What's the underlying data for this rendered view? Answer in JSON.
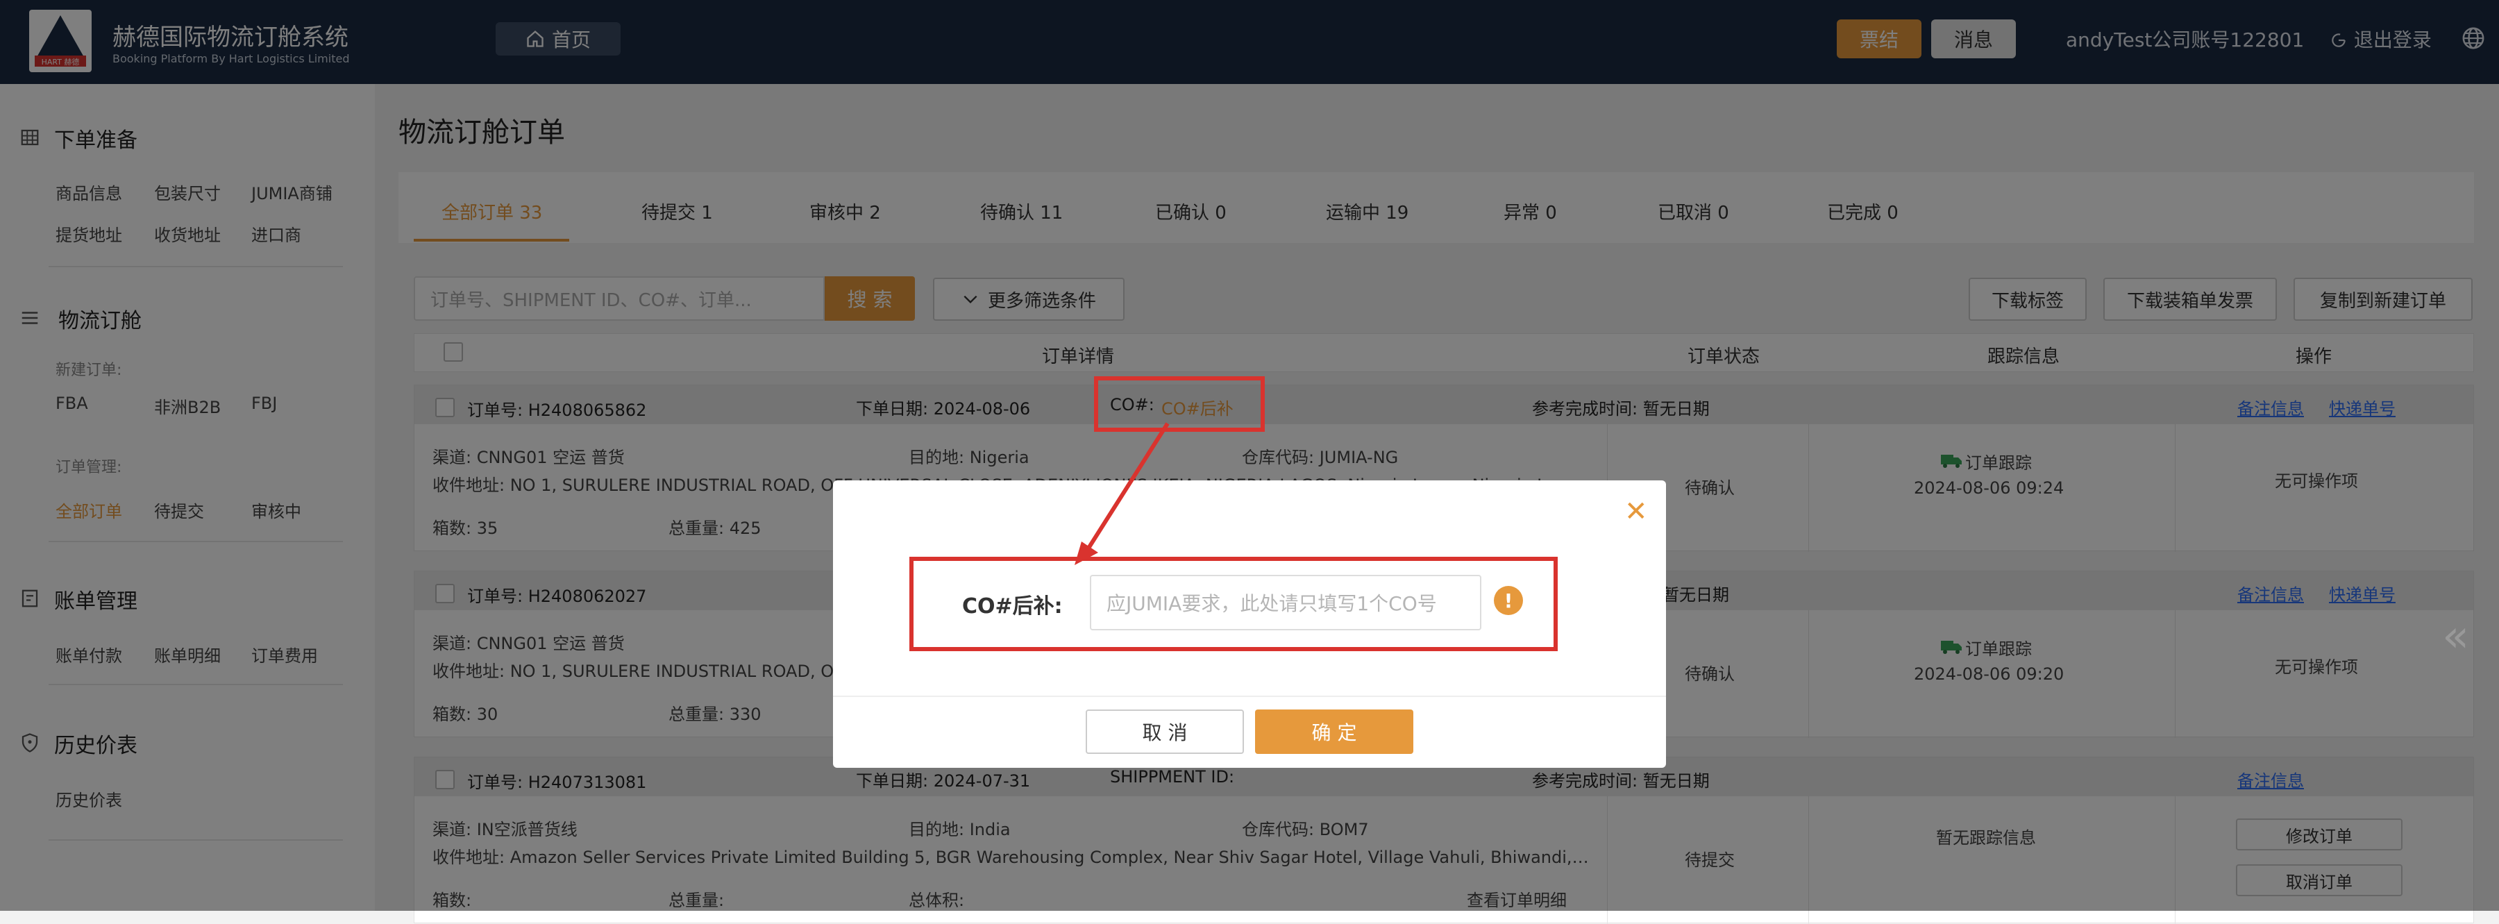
{
  "header": {
    "title": "赫德国际物流订舱系统",
    "subtitle": "Booking Platform By Hart Logistics Limited",
    "logo_text": "HART 赫德",
    "home": "首页",
    "invoice": "票结",
    "messages": "消息",
    "account": "andyTest公司账号122801",
    "logout": "退出登录"
  },
  "sidebar": {
    "section1": {
      "title": "下单准备",
      "items": [
        "商品信息",
        "包装尺寸",
        "JUMIA商铺",
        "提货地址",
        "收货地址",
        "进口商"
      ]
    },
    "section2": {
      "title": "物流订舱",
      "new_label": "新建订单:",
      "new_items": [
        "FBA",
        "非洲B2B",
        "FBJ"
      ],
      "manage_label": "订单管理:",
      "manage_items": [
        "全部订单",
        "待提交",
        "审核中"
      ]
    },
    "section3": {
      "title": "账单管理",
      "items": [
        "账单付款",
        "账单明细",
        "订单费用"
      ]
    },
    "section4": {
      "title": "历史价表",
      "items": [
        "历史价表"
      ]
    }
  },
  "main": {
    "page_title": "物流订舱订单",
    "tabs": [
      "全部订单 33",
      "待提交 1",
      "审核中 2",
      "待确认 11",
      "已确认 0",
      "运输中 19",
      "异常 0",
      "已取消 0",
      "已完成 0"
    ],
    "search_placeholder": "订单号、SHIPMENT ID、CO#、订单...",
    "search_btn": "搜 索",
    "more_filters": "更多筛选条件",
    "actions": [
      "下载标签",
      "下载装箱单发票",
      "复制到新建订单"
    ],
    "columns": [
      "订单详情",
      "订单状态",
      "跟踪信息",
      "操作"
    ]
  },
  "orders": [
    {
      "order_no": "订单号:  H2408065862",
      "date": "下单日期:  2024-08-06",
      "co_label": "CO#:",
      "co_value": "CO#后补",
      "ref_time": "参考完成时间:  暂无日期",
      "channel": "渠道:  CNNG01 空运 普货",
      "dest": "目的地:  Nigeria",
      "warehouse": "仓库代码:  JUMIA-NG",
      "address": "收件地址:   NO 1, SURULERE INDUSTRIAL ROAD, OFF UNIVERSAL CLOSE, ADENIYI JONES IKEJA, NIGERIA LAGOS, Nigeria Lagos, Nigeria La...",
      "boxes": "箱数:  35",
      "weight": "总重量:  425",
      "status": "待确认",
      "track_link": "订单跟踪",
      "track_time": "2024-08-06 09:24",
      "op": "无可操作项",
      "links": [
        "备注信息",
        "快递单号"
      ]
    },
    {
      "order_no": "订单号:  H2408062027",
      "ref_time": "暂无日期",
      "channel": "渠道:  CNNG01 空运 普货",
      "address": "收件地址:   NO 1, SURULERE INDUSTRIAL ROAD, O",
      "boxes": "箱数:  30",
      "weight": "总重量:  330",
      "status": "待确认",
      "track_link": "订单跟踪",
      "track_time": "2024-08-06 09:20",
      "op": "无可操作项",
      "links": [
        "备注信息",
        "快递单号"
      ]
    },
    {
      "order_no": "订单号:  H2407313081",
      "date": "下单日期:  2024-07-31",
      "shipment": "SHIPPMENT ID:",
      "ref_time": "参考完成时间:  暂无日期",
      "channel": "渠道:  IN空派普货线",
      "dest": "目的地:  India",
      "warehouse": "仓库代码:  BOM7",
      "address": "收件地址:   Amazon Seller Services Private Limited Building 5, BGR Warehousing Complex, Near Shiv Sagar Hotel, Village Vahuli, Bhiwandi,Ma...",
      "boxes": "箱数:",
      "weight": "总重量:",
      "volume": "总体积:",
      "detail_link": "查看订单明细",
      "status": "待提交",
      "track_none": "暂无跟踪信息",
      "op_buttons": [
        "修改订单",
        "取消订单"
      ],
      "links": [
        "备注信息"
      ]
    }
  ],
  "modal": {
    "label": "CO#后补:",
    "placeholder": "应JUMIA要求，此处请只填写1个CO号",
    "warn": "!",
    "cancel": "取 消",
    "confirm": "确 定"
  },
  "colors": {
    "accent": "#e6993c",
    "header_bg": "#1a2b43",
    "annotation": "#d9332e",
    "link": "#2d6df5"
  }
}
